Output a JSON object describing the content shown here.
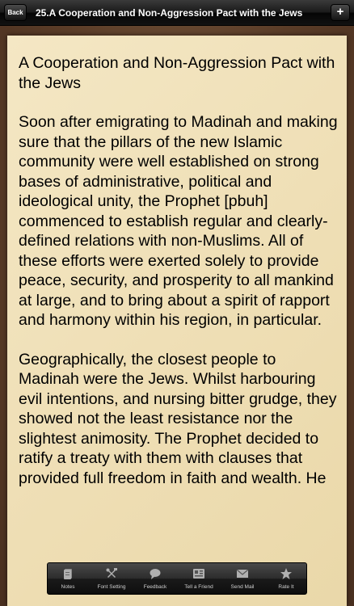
{
  "navbar": {
    "back_label": "Back",
    "title": "25.A Cooperation and Non-Aggression Pact with the Jews",
    "add_label": "+"
  },
  "article": {
    "heading": "A Cooperation and Non-Aggression Pact with the Jews",
    "paragraphs": [
      "Soon after emigrating to Madinah and making sure that the pillars of the new Islamic community were well established on strong bases of administrative, political and ideological unity, the Prophet [pbuh] commenced to establish regular and clearly-defined relations with non-Muslims. All of these efforts were exerted solely to provide peace, security, and prosperity to all mankind at large, and to bring about a spirit of rapport and harmony within his region, in particular.",
      "Geographically, the closest people to Madinah were the Jews. Whilst harbouring evil intentions, and nursing bitter grudge, they showed not the least resistance nor the slightest animosity. The Prophet decided to ratify a treaty with them with clauses that provided full freedom in faith and wealth. He"
    ]
  },
  "toolbar": {
    "items": [
      {
        "label": "Notes",
        "icon": "notes-icon"
      },
      {
        "label": "Font Setting",
        "icon": "tools-icon"
      },
      {
        "label": "Feedback",
        "icon": "feedback-icon"
      },
      {
        "label": "Tell a Friend",
        "icon": "contact-card-icon"
      },
      {
        "label": "Send Mail",
        "icon": "mail-icon"
      },
      {
        "label": "Rate It",
        "icon": "star-icon"
      }
    ]
  }
}
